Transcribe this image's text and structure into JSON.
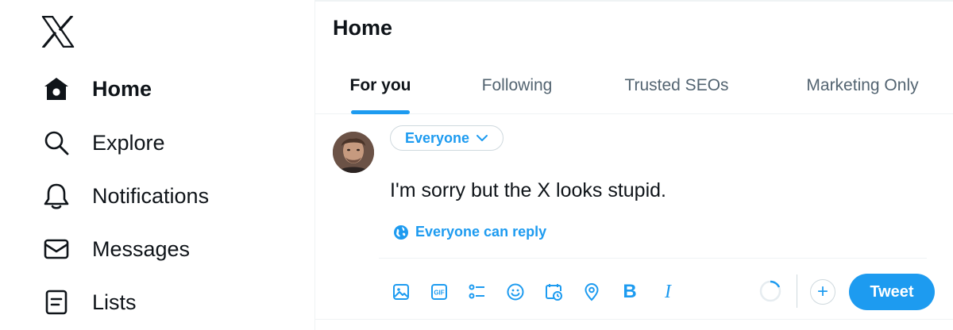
{
  "brand": {
    "logo_icon": "x-logo-icon"
  },
  "sidebar": {
    "items": [
      {
        "label": "Home",
        "icon": "home-icon",
        "active": true
      },
      {
        "label": "Explore",
        "icon": "search-icon",
        "active": false
      },
      {
        "label": "Notifications",
        "icon": "bell-icon",
        "active": false
      },
      {
        "label": "Messages",
        "icon": "envelope-icon",
        "active": false
      },
      {
        "label": "Lists",
        "icon": "list-icon",
        "active": false
      }
    ]
  },
  "header": {
    "title": "Home"
  },
  "tabs": [
    {
      "label": "For you",
      "active": true
    },
    {
      "label": "Following",
      "active": false
    },
    {
      "label": "Trusted SEOs",
      "active": false
    },
    {
      "label": "Marketing Only",
      "active": false
    }
  ],
  "composer": {
    "audience_label": "Everyone",
    "text": "I'm sorry but the X looks stupid.",
    "reply_setting": "Everyone can reply",
    "toolbar_icons": [
      "image-icon",
      "gif-icon",
      "poll-icon",
      "emoji-icon",
      "schedule-icon",
      "location-icon",
      "bold-icon",
      "italic-icon"
    ],
    "bold_glyph": "B",
    "italic_glyph": "I",
    "add_glyph": "+",
    "tweet_label": "Tweet"
  },
  "colors": {
    "accent": "#1d9bf0",
    "text": "#0f1419",
    "muted": "#536471",
    "border": "#cfd9de"
  }
}
